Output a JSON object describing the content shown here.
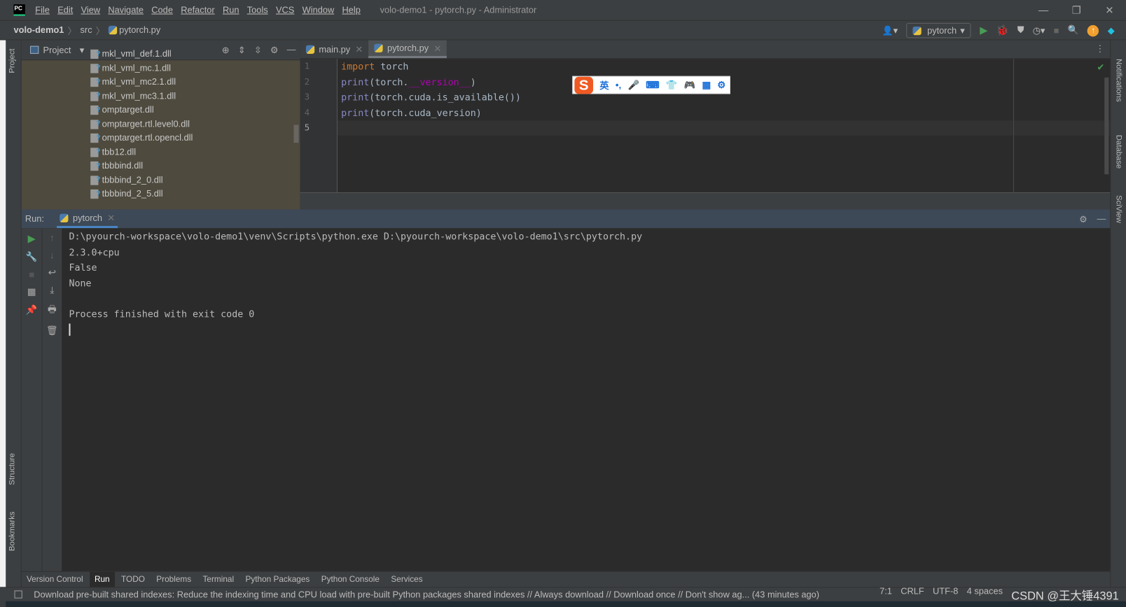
{
  "titlebar": {
    "logo": "PC",
    "menu": [
      "File",
      "Edit",
      "View",
      "Navigate",
      "Code",
      "Refactor",
      "Run",
      "Tools",
      "VCS",
      "Window",
      "Help"
    ],
    "title": "volo-demo1 - pytorch.py - Administrator"
  },
  "navbar": {
    "breadcrumb": [
      "volo-demo1",
      "src",
      "pytorch.py"
    ],
    "run_config": "pytorch"
  },
  "left_strip": {
    "project": "Project",
    "structure": "Structure",
    "bookmarks": "Bookmarks"
  },
  "project": {
    "title": "Project",
    "files": [
      "mkl_vml_def.1.dll",
      "mkl_vml_mc.1.dll",
      "mkl_vml_mc2.1.dll",
      "mkl_vml_mc3.1.dll",
      "omptarget.dll",
      "omptarget.rtl.level0.dll",
      "omptarget.rtl.opencl.dll",
      "tbb12.dll",
      "tbbbind.dll",
      "tbbbind_2_0.dll",
      "tbbbind_2_5.dll"
    ]
  },
  "editor": {
    "tabs": [
      "main.py",
      "pytorch.py"
    ],
    "active_tab": "pytorch.py",
    "line_numbers": [
      "1",
      "2",
      "3",
      "4",
      "5"
    ],
    "code": {
      "l1a": "import",
      "l1b": " torch",
      "l2a": "print",
      "l2b": "(torch.",
      "l2c": "__version__",
      "l2d": ")",
      "l3a": "print",
      "l3b": "(torch.cuda.is_available())",
      "l4a": "print",
      "l4b": "(torch.cuda_version)"
    }
  },
  "ime": {
    "logo": "S",
    "mode": "英",
    "punct": "•,"
  },
  "run": {
    "label": "Run:",
    "tab": "pytorch",
    "output": [
      "D:\\pyourch-workspace\\volo-demo1\\venv\\Scripts\\python.exe D:\\pyourch-workspace\\volo-demo1\\src\\pytorch.py",
      "2.3.0+cpu",
      "False",
      "None",
      "",
      "Process finished with exit code 0"
    ]
  },
  "right_strip": {
    "notifications": "Notifications",
    "database": "Database",
    "sciview": "SciView"
  },
  "bottom_tabs": [
    "Version Control",
    "Run",
    "TODO",
    "Problems",
    "Terminal",
    "Python Packages",
    "Python Console",
    "Services"
  ],
  "status": {
    "message": "Download pre-built shared indexes: Reduce the indexing time and CPU load with pre-built Python packages shared indexes // Always download // Download once // Don't show ag... (43 minutes ago)",
    "position": "7:1",
    "line_sep": "CRLF",
    "encoding": "UTF-8",
    "indent": "4 spaces",
    "watermark": "CSDN @王大锤4391"
  }
}
